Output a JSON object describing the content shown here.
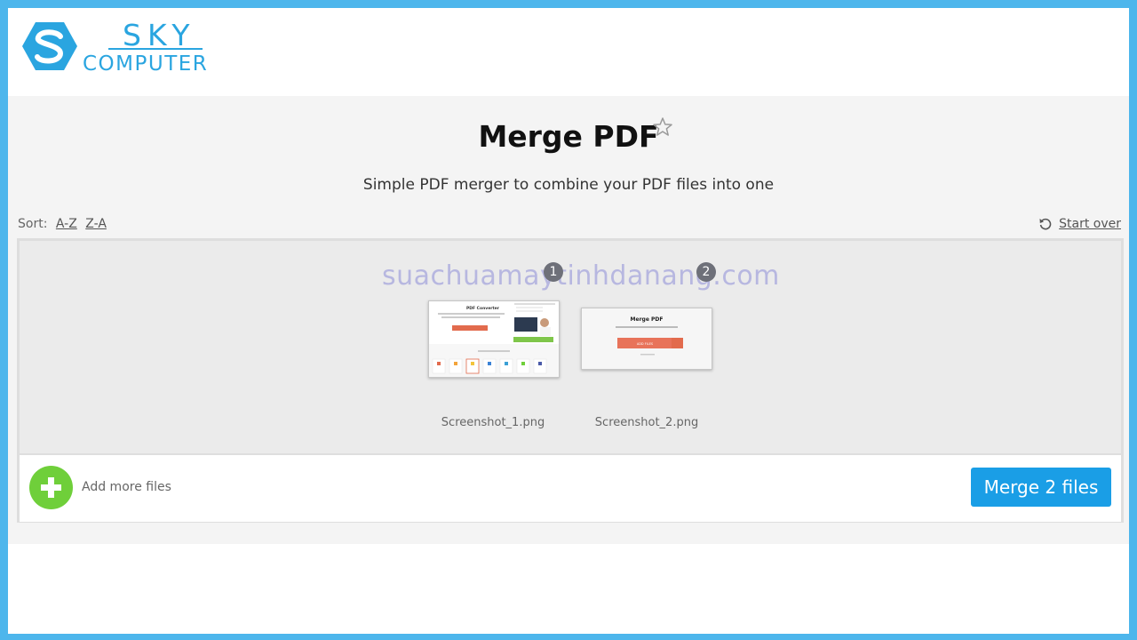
{
  "brand": {
    "line1": "SKY",
    "line2": "COMPUTER"
  },
  "header": {
    "title": "Merge PDF",
    "subtitle": "Simple PDF merger to combine your PDF files into one"
  },
  "sort": {
    "label": "Sort:",
    "az": "A-Z",
    "za": "Z-A"
  },
  "start_over": "Start over",
  "watermark": "suachuamaytinhdanang.com",
  "files": [
    {
      "index": "1",
      "name": "Screenshot_1.png"
    },
    {
      "index": "2",
      "name": "Screenshot_2.png"
    }
  ],
  "thumb2": {
    "title": "Merge PDF",
    "button": "ADD FILES"
  },
  "thumb1": {
    "title": "PDF Converter",
    "button": "Choose Files"
  },
  "bottom": {
    "add_label": "Add more files",
    "merge_label": "Merge 2 files"
  },
  "colors": {
    "accent": "#1a9ee6",
    "add": "#6fcf3a",
    "frame": "#4db6ec",
    "brand": "#2aa5e0"
  }
}
